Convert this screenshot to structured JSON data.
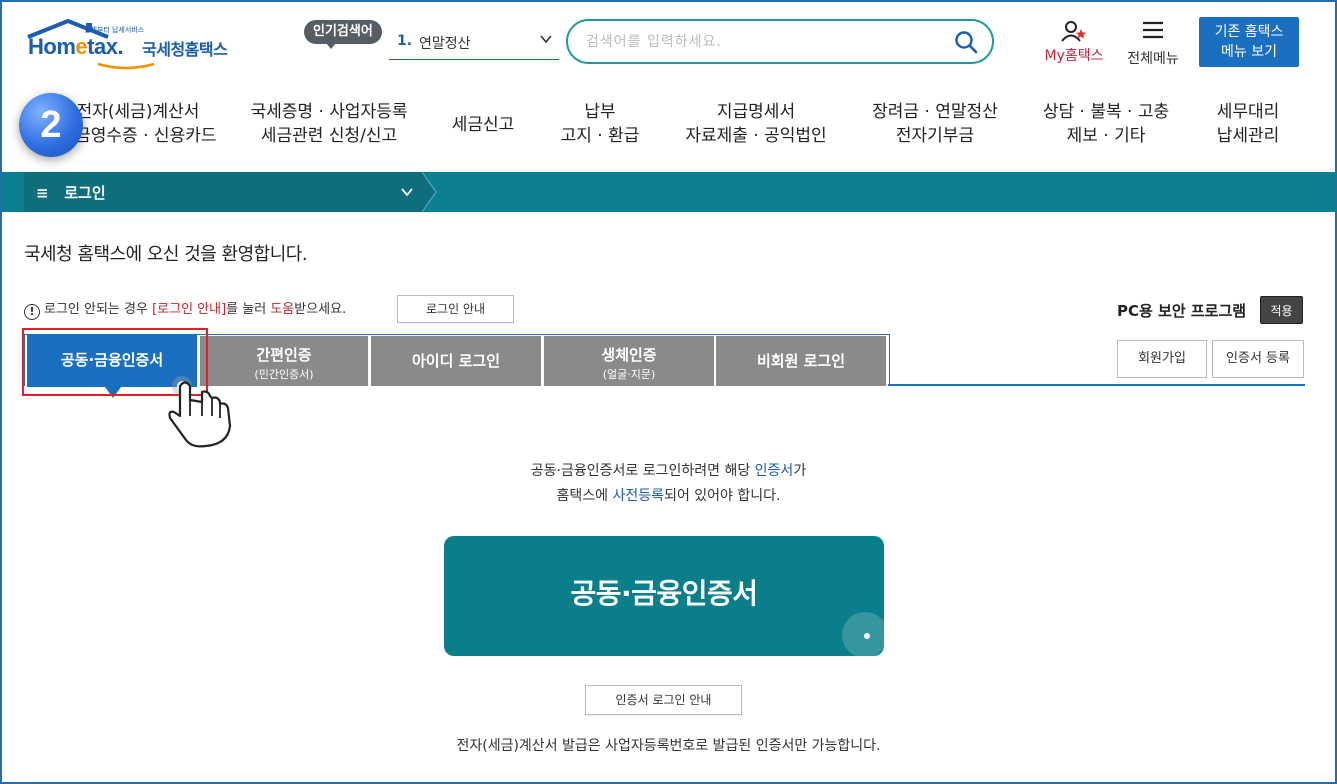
{
  "header": {
    "logo": {
      "tagline": "언제부터 납세서비스",
      "brand_prefix": "Hom",
      "brand_e": "e",
      "brand_suffix": "tax.",
      "korean": "국세청홈택스"
    },
    "popular": {
      "badge": "인기검색어",
      "rank": "1.",
      "keyword": "연말정산"
    },
    "search": {
      "placeholder": "검색어를 입력하세요."
    },
    "my_label": "My홈택스",
    "all_menu_label": "전체메뉴",
    "old_menu_line1": "기존 홈택스",
    "old_menu_line2": "메뉴 보기"
  },
  "gnb": [
    {
      "line1": "전자(세금)계산서",
      "line2": "현금영수증 · 신용카드"
    },
    {
      "line1": "국세증명 · 사업자등록",
      "line2": "세금관련 신청/신고"
    },
    {
      "line1": "세금신고",
      "line2": ""
    },
    {
      "line1": "납부",
      "line2": "고지 · 환급"
    },
    {
      "line1": "지급명세서",
      "line2": "자료제출 · 공익법인"
    },
    {
      "line1": "장려금 · 연말정산",
      "line2": "전자기부금"
    },
    {
      "line1": "상담 · 불복 · 고충",
      "line2": "제보 · 기타"
    },
    {
      "line1": "세무대리",
      "line2": "납세관리"
    }
  ],
  "step_number": "2",
  "breadcrumb": {
    "label": "로그인"
  },
  "main": {
    "welcome": "국세청 홈택스에 오신 것을 환영합니다.",
    "notice_prefix": "로그인 안되는 경우 ",
    "notice_link": "[로그인 안내]",
    "notice_mid": "를 눌러 ",
    "notice_help": "도움",
    "notice_suffix": "받으세요.",
    "login_guide_button": "로그인 안내",
    "pc_security_label": "PC용 보안 프로그램",
    "apply_button": "적용",
    "join_button": "회원가입",
    "cert_register_button": "인증서 등록",
    "tabs": [
      {
        "label": "공동·금융인증서",
        "sub": ""
      },
      {
        "label": "간편인증",
        "sub": "(민간인증서)"
      },
      {
        "label": "아이디 로그인",
        "sub": ""
      },
      {
        "label": "생체인증",
        "sub": "(얼굴·지문)"
      },
      {
        "label": "비회원 로그인",
        "sub": ""
      }
    ],
    "desc_line1_a": "공동·금융인증서로 로그인하려면 해당 ",
    "desc_line1_b": "인증서",
    "desc_line1_c": "가",
    "desc_line2_a": "홈택스에 ",
    "desc_line2_b": "사전등록",
    "desc_line2_c": "되어 있어야 합니다.",
    "big_button": "공동·금융인증서",
    "cert_login_guide_button": "인증서 로그인 안내",
    "footnote": "전자(세금)계산서 발급은 사업자등록번호로 발급된 인증서만 가능합니다."
  },
  "colors": {
    "teal": "#0a7f90",
    "blue": "#1b6fc1",
    "red_highlight": "#e0202a",
    "tab_inactive": "#8a8a8a"
  }
}
